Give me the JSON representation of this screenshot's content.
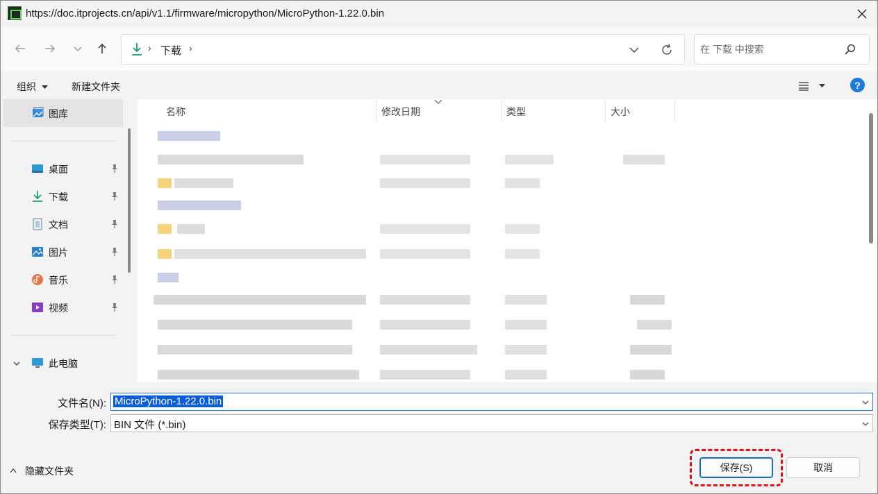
{
  "window": {
    "title": "https://doc.itprojects.cn/api/v1.1/firmware/micropython/MicroPython-1.22.0.bin"
  },
  "nav": {
    "address_crumb": "下载",
    "search_placeholder": "在 下载 中搜索"
  },
  "toolbar": {
    "organize_label": "组织",
    "new_folder_label": "新建文件夹",
    "help_label": "?"
  },
  "sidebar": {
    "items": [
      {
        "label": "图库"
      },
      {
        "label": "桌面"
      },
      {
        "label": "下载"
      },
      {
        "label": "文档"
      },
      {
        "label": "图片"
      },
      {
        "label": "音乐"
      },
      {
        "label": "视频"
      },
      {
        "label": "此电脑"
      }
    ]
  },
  "columns": {
    "name": "名称",
    "modified": "修改日期",
    "type": "类型",
    "size": "大小"
  },
  "form": {
    "filename_label": "文件名(N):",
    "filename_value": "MicroPython-1.22.0.bin",
    "filetype_label": "保存类型(T):",
    "filetype_value": "BIN 文件 (*.bin)"
  },
  "footer": {
    "hide_folders_label": "隐藏文件夹",
    "save_label": "保存(S)",
    "cancel_label": "取消"
  },
  "colors": {
    "accent": "#1f6bc4",
    "highlight": "#d9141a",
    "selection": "#0b5cd7"
  }
}
